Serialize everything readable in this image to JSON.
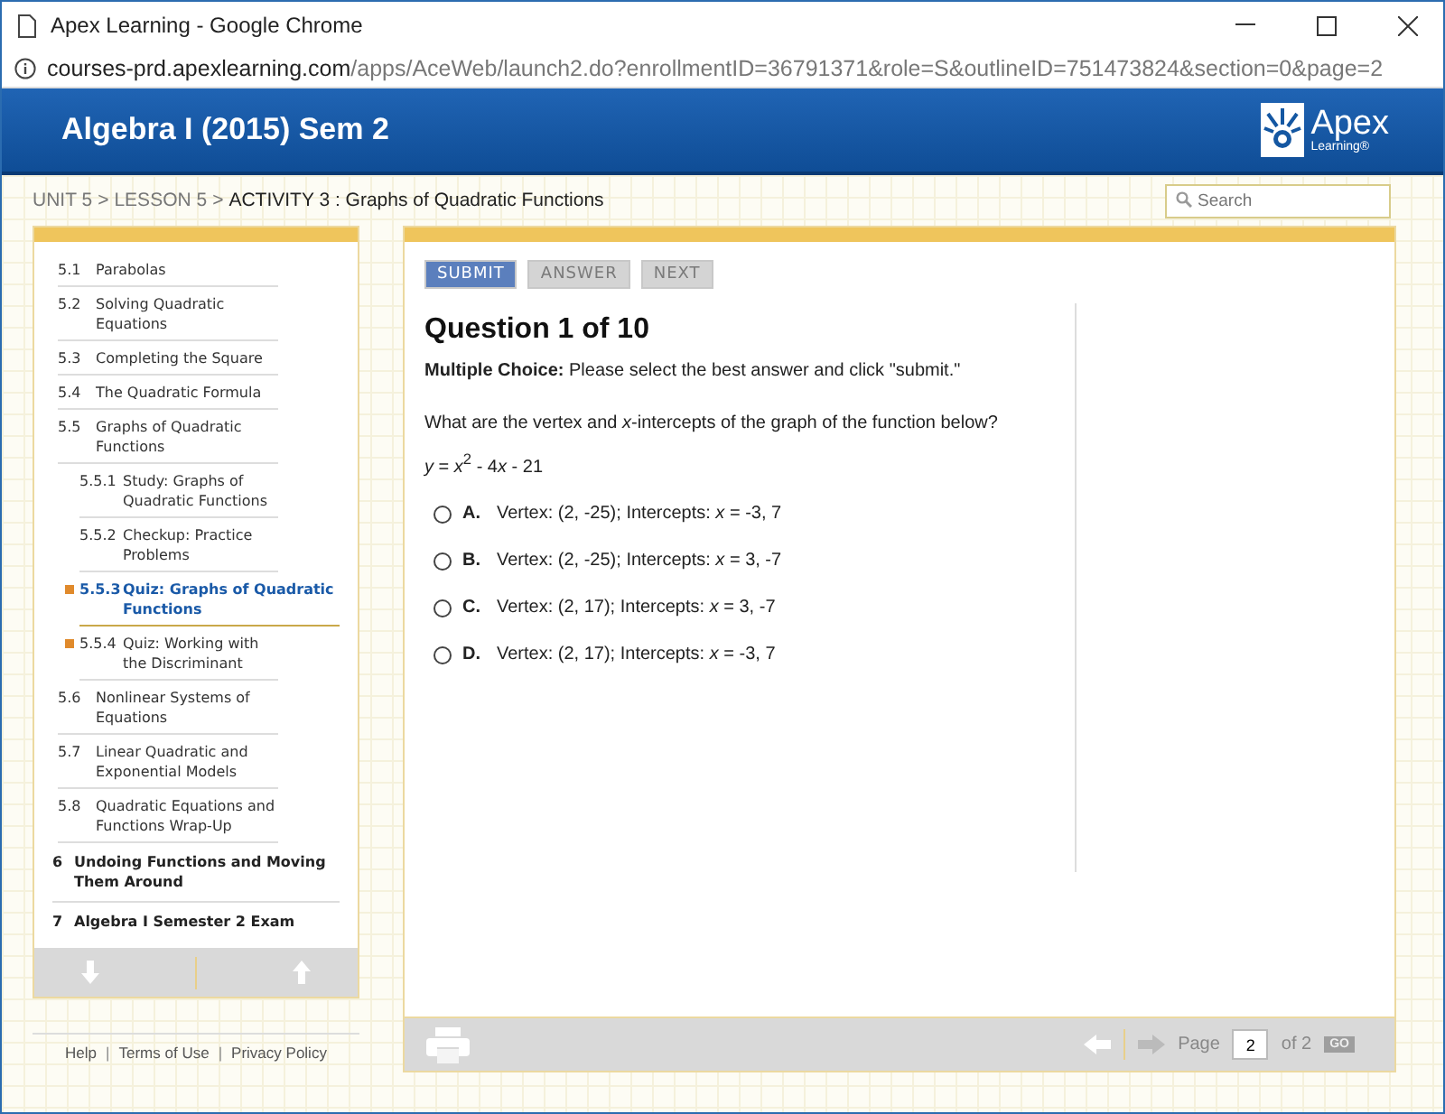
{
  "window": {
    "title": "Apex Learning - Google Chrome"
  },
  "address": {
    "host": "courses-prd.apexlearning.com",
    "path": "/apps/AceWeb/launch2.do?enrollmentID=36791371&role=S&outlineID=751473824&section=0&page=2"
  },
  "header": {
    "course": "Algebra I (2015) Sem 2",
    "logo_name": "Apex",
    "logo_tagline": "Learning®"
  },
  "breadcrumb": [
    {
      "kind": "link",
      "label": "UNIT 5",
      "current": false
    },
    {
      "kind": "separator",
      "label": ">"
    },
    {
      "kind": "link",
      "label": "LESSON 5",
      "current": false
    },
    {
      "kind": "separator",
      "label": ">"
    },
    {
      "kind": "link",
      "label": "ACTIVITY 3 : Graphs of Quadratic Functions",
      "current": true
    }
  ],
  "search": {
    "placeholder": "Search"
  },
  "outline": [
    {
      "kind": "lesson",
      "number": "5.1",
      "title": "Parabolas",
      "selected": false
    },
    {
      "kind": "lesson",
      "number": "5.2",
      "title": "Solving Quadratic Equations",
      "selected": false
    },
    {
      "kind": "lesson",
      "number": "5.3",
      "title": "Completing the Square",
      "selected": false
    },
    {
      "kind": "lesson",
      "number": "5.4",
      "title": "The Quadratic Formula",
      "selected": false
    },
    {
      "kind": "lesson",
      "number": "5.5",
      "title": "Graphs of Quadratic Functions",
      "selected": false,
      "children": [
        {
          "kind": "activity",
          "number": "5.5.1",
          "title": "Study: Graphs of Quadratic Functions",
          "selected": false,
          "flagged": false
        },
        {
          "kind": "activity",
          "number": "5.5.2",
          "title": "Checkup: Practice Problems",
          "selected": false,
          "flagged": false
        },
        {
          "kind": "activity",
          "number": "5.5.3",
          "title": "Quiz: Graphs of Quadratic Functions",
          "selected": true,
          "flagged": true
        },
        {
          "kind": "activity",
          "number": "5.5.4",
          "title": "Quiz: Working with the Discriminant",
          "selected": false,
          "flagged": true
        }
      ]
    },
    {
      "kind": "lesson",
      "number": "5.6",
      "title": "Nonlinear Systems of Equations",
      "selected": false
    },
    {
      "kind": "lesson",
      "number": "5.7",
      "title": "Linear Quadratic and Exponential Models",
      "selected": false
    },
    {
      "kind": "lesson",
      "number": "5.8",
      "title": "Quadratic Equations and Functions Wrap-Up",
      "selected": false
    },
    {
      "kind": "unit",
      "number": "6",
      "title": "Undoing Functions and Moving Them Around",
      "selected": false
    },
    {
      "kind": "unit",
      "number": "7",
      "title": "Algebra I Semester 2 Exam",
      "selected": false
    }
  ],
  "footer_links": [
    {
      "kind": "link",
      "label": "Help"
    },
    {
      "kind": "separator",
      "label": "|"
    },
    {
      "kind": "link",
      "label": "Terms of Use"
    },
    {
      "kind": "separator",
      "label": "|"
    },
    {
      "kind": "link",
      "label": "Privacy Policy"
    }
  ],
  "buttons": [
    {
      "label": "SUBMIT",
      "disabled": false
    },
    {
      "label": "ANSWER",
      "disabled": true
    },
    {
      "label": "NEXT",
      "disabled": true
    }
  ],
  "question": {
    "title": "Question 1 of 10",
    "instruction": "**Multiple Choice:** Please select the best answer and click \"submit.\"",
    "prompt": "What are the vertex and *x*-intercepts of the graph of the function below?",
    "equation": [
      {
        "kind": "variable",
        "text": "y"
      },
      {
        "kind": "text",
        "text": " = "
      },
      {
        "kind": "variable",
        "text": "x"
      },
      {
        "kind": "exponent",
        "text": "2"
      },
      {
        "kind": "text",
        "text": " - 4"
      },
      {
        "kind": "variable",
        "text": "x"
      },
      {
        "kind": "text",
        "text": " - 21"
      }
    ],
    "options": [
      {
        "letter": "A.",
        "text": "Vertex: (2, -25); Intercepts: *x* = -3, 7",
        "selected": false
      },
      {
        "letter": "B.",
        "text": "Vertex: (2, -25); Intercepts: *x* = 3, -7",
        "selected": false
      },
      {
        "letter": "C.",
        "text": "Vertex: (2, 17); Intercepts: *x* = 3, -7",
        "selected": false
      },
      {
        "letter": "D.",
        "text": "Vertex: (2, 17); Intercepts: *x* = -3, 7",
        "selected": false
      }
    ]
  },
  "pager": {
    "prev_disabled": false,
    "next_disabled": true,
    "label": "Page",
    "value": "2",
    "total": "of 2",
    "go": "GO"
  }
}
